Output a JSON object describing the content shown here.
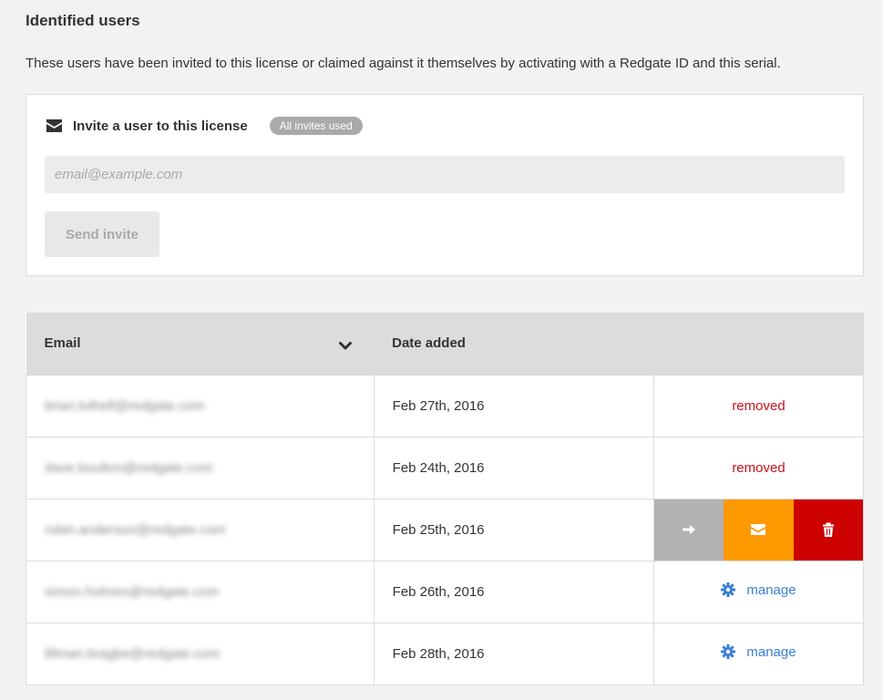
{
  "section": {
    "title": "Identified users",
    "description": "These users have been invited to this license or claimed against it themselves by activating with a Redgate ID and this serial."
  },
  "invite": {
    "label": "Invite a user to this license",
    "badge": "All invites used",
    "email_placeholder": "email@example.com",
    "send_label": "Send invite"
  },
  "table": {
    "headers": {
      "email": "Email",
      "date": "Date added"
    },
    "rows": [
      {
        "email": "brian.luthell@redgate.com",
        "date": "Feb 27th, 2016",
        "status": "removed"
      },
      {
        "email": "dave.boulton@redgate.com",
        "date": "Feb 24th, 2016",
        "status": "removed"
      },
      {
        "email": "robin.anderson@redgate.com",
        "date": "Feb 25th, 2016",
        "status": "actions"
      },
      {
        "email": "simon.holmes@redgate.com",
        "date": "Feb 26th, 2016",
        "status": "manage"
      },
      {
        "email": "lillman.bragbe@redgate.com",
        "date": "Feb 28th, 2016",
        "status": "manage"
      }
    ],
    "status_labels": {
      "removed": "removed",
      "manage": "manage"
    }
  },
  "icons": {
    "invite": "mail-icon",
    "sort": "chevron-down-icon",
    "manage": "gear-icon",
    "transfer": "arrow-right-icon",
    "resend": "mail-icon",
    "delete": "trash-icon"
  },
  "colors": {
    "removed": "#c9101a",
    "manage": "#3a7fd4",
    "transfer": "#b2b2b2",
    "resend": "#ff9900",
    "delete": "#cc0000",
    "badge": "#aaaaaa"
  }
}
